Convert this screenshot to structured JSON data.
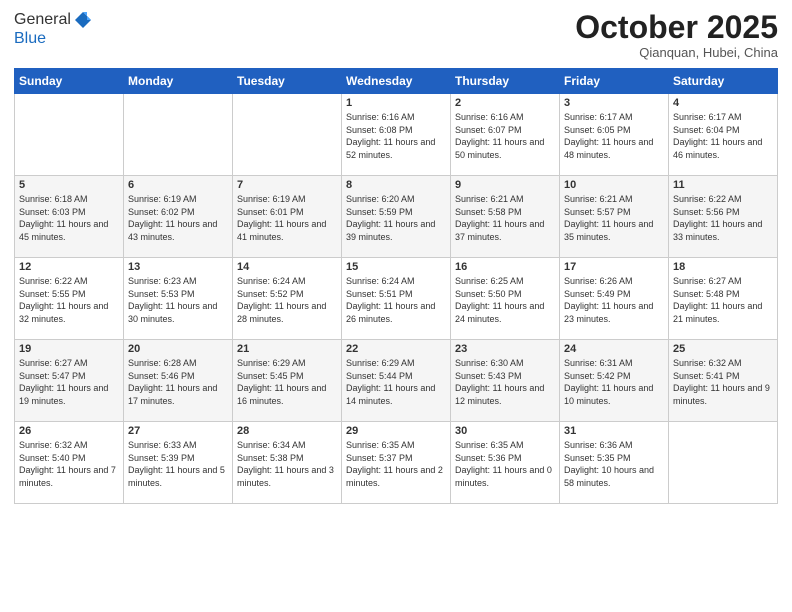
{
  "logo": {
    "general": "General",
    "blue": "Blue"
  },
  "header": {
    "month": "October 2025",
    "location": "Qianquan, Hubei, China"
  },
  "weekdays": [
    "Sunday",
    "Monday",
    "Tuesday",
    "Wednesday",
    "Thursday",
    "Friday",
    "Saturday"
  ],
  "weeks": [
    [
      {
        "day": "",
        "sunrise": "",
        "sunset": "",
        "daylight": ""
      },
      {
        "day": "",
        "sunrise": "",
        "sunset": "",
        "daylight": ""
      },
      {
        "day": "",
        "sunrise": "",
        "sunset": "",
        "daylight": ""
      },
      {
        "day": "1",
        "sunrise": "Sunrise: 6:16 AM",
        "sunset": "Sunset: 6:08 PM",
        "daylight": "Daylight: 11 hours and 52 minutes."
      },
      {
        "day": "2",
        "sunrise": "Sunrise: 6:16 AM",
        "sunset": "Sunset: 6:07 PM",
        "daylight": "Daylight: 11 hours and 50 minutes."
      },
      {
        "day": "3",
        "sunrise": "Sunrise: 6:17 AM",
        "sunset": "Sunset: 6:05 PM",
        "daylight": "Daylight: 11 hours and 48 minutes."
      },
      {
        "day": "4",
        "sunrise": "Sunrise: 6:17 AM",
        "sunset": "Sunset: 6:04 PM",
        "daylight": "Daylight: 11 hours and 46 minutes."
      }
    ],
    [
      {
        "day": "5",
        "sunrise": "Sunrise: 6:18 AM",
        "sunset": "Sunset: 6:03 PM",
        "daylight": "Daylight: 11 hours and 45 minutes."
      },
      {
        "day": "6",
        "sunrise": "Sunrise: 6:19 AM",
        "sunset": "Sunset: 6:02 PM",
        "daylight": "Daylight: 11 hours and 43 minutes."
      },
      {
        "day": "7",
        "sunrise": "Sunrise: 6:19 AM",
        "sunset": "Sunset: 6:01 PM",
        "daylight": "Daylight: 11 hours and 41 minutes."
      },
      {
        "day": "8",
        "sunrise": "Sunrise: 6:20 AM",
        "sunset": "Sunset: 5:59 PM",
        "daylight": "Daylight: 11 hours and 39 minutes."
      },
      {
        "day": "9",
        "sunrise": "Sunrise: 6:21 AM",
        "sunset": "Sunset: 5:58 PM",
        "daylight": "Daylight: 11 hours and 37 minutes."
      },
      {
        "day": "10",
        "sunrise": "Sunrise: 6:21 AM",
        "sunset": "Sunset: 5:57 PM",
        "daylight": "Daylight: 11 hours and 35 minutes."
      },
      {
        "day": "11",
        "sunrise": "Sunrise: 6:22 AM",
        "sunset": "Sunset: 5:56 PM",
        "daylight": "Daylight: 11 hours and 33 minutes."
      }
    ],
    [
      {
        "day": "12",
        "sunrise": "Sunrise: 6:22 AM",
        "sunset": "Sunset: 5:55 PM",
        "daylight": "Daylight: 11 hours and 32 minutes."
      },
      {
        "day": "13",
        "sunrise": "Sunrise: 6:23 AM",
        "sunset": "Sunset: 5:53 PM",
        "daylight": "Daylight: 11 hours and 30 minutes."
      },
      {
        "day": "14",
        "sunrise": "Sunrise: 6:24 AM",
        "sunset": "Sunset: 5:52 PM",
        "daylight": "Daylight: 11 hours and 28 minutes."
      },
      {
        "day": "15",
        "sunrise": "Sunrise: 6:24 AM",
        "sunset": "Sunset: 5:51 PM",
        "daylight": "Daylight: 11 hours and 26 minutes."
      },
      {
        "day": "16",
        "sunrise": "Sunrise: 6:25 AM",
        "sunset": "Sunset: 5:50 PM",
        "daylight": "Daylight: 11 hours and 24 minutes."
      },
      {
        "day": "17",
        "sunrise": "Sunrise: 6:26 AM",
        "sunset": "Sunset: 5:49 PM",
        "daylight": "Daylight: 11 hours and 23 minutes."
      },
      {
        "day": "18",
        "sunrise": "Sunrise: 6:27 AM",
        "sunset": "Sunset: 5:48 PM",
        "daylight": "Daylight: 11 hours and 21 minutes."
      }
    ],
    [
      {
        "day": "19",
        "sunrise": "Sunrise: 6:27 AM",
        "sunset": "Sunset: 5:47 PM",
        "daylight": "Daylight: 11 hours and 19 minutes."
      },
      {
        "day": "20",
        "sunrise": "Sunrise: 6:28 AM",
        "sunset": "Sunset: 5:46 PM",
        "daylight": "Daylight: 11 hours and 17 minutes."
      },
      {
        "day": "21",
        "sunrise": "Sunrise: 6:29 AM",
        "sunset": "Sunset: 5:45 PM",
        "daylight": "Daylight: 11 hours and 16 minutes."
      },
      {
        "day": "22",
        "sunrise": "Sunrise: 6:29 AM",
        "sunset": "Sunset: 5:44 PM",
        "daylight": "Daylight: 11 hours and 14 minutes."
      },
      {
        "day": "23",
        "sunrise": "Sunrise: 6:30 AM",
        "sunset": "Sunset: 5:43 PM",
        "daylight": "Daylight: 11 hours and 12 minutes."
      },
      {
        "day": "24",
        "sunrise": "Sunrise: 6:31 AM",
        "sunset": "Sunset: 5:42 PM",
        "daylight": "Daylight: 11 hours and 10 minutes."
      },
      {
        "day": "25",
        "sunrise": "Sunrise: 6:32 AM",
        "sunset": "Sunset: 5:41 PM",
        "daylight": "Daylight: 11 hours and 9 minutes."
      }
    ],
    [
      {
        "day": "26",
        "sunrise": "Sunrise: 6:32 AM",
        "sunset": "Sunset: 5:40 PM",
        "daylight": "Daylight: 11 hours and 7 minutes."
      },
      {
        "day": "27",
        "sunrise": "Sunrise: 6:33 AM",
        "sunset": "Sunset: 5:39 PM",
        "daylight": "Daylight: 11 hours and 5 minutes."
      },
      {
        "day": "28",
        "sunrise": "Sunrise: 6:34 AM",
        "sunset": "Sunset: 5:38 PM",
        "daylight": "Daylight: 11 hours and 3 minutes."
      },
      {
        "day": "29",
        "sunrise": "Sunrise: 6:35 AM",
        "sunset": "Sunset: 5:37 PM",
        "daylight": "Daylight: 11 hours and 2 minutes."
      },
      {
        "day": "30",
        "sunrise": "Sunrise: 6:35 AM",
        "sunset": "Sunset: 5:36 PM",
        "daylight": "Daylight: 11 hours and 0 minutes."
      },
      {
        "day": "31",
        "sunrise": "Sunrise: 6:36 AM",
        "sunset": "Sunset: 5:35 PM",
        "daylight": "Daylight: 10 hours and 58 minutes."
      },
      {
        "day": "",
        "sunrise": "",
        "sunset": "",
        "daylight": ""
      }
    ]
  ]
}
